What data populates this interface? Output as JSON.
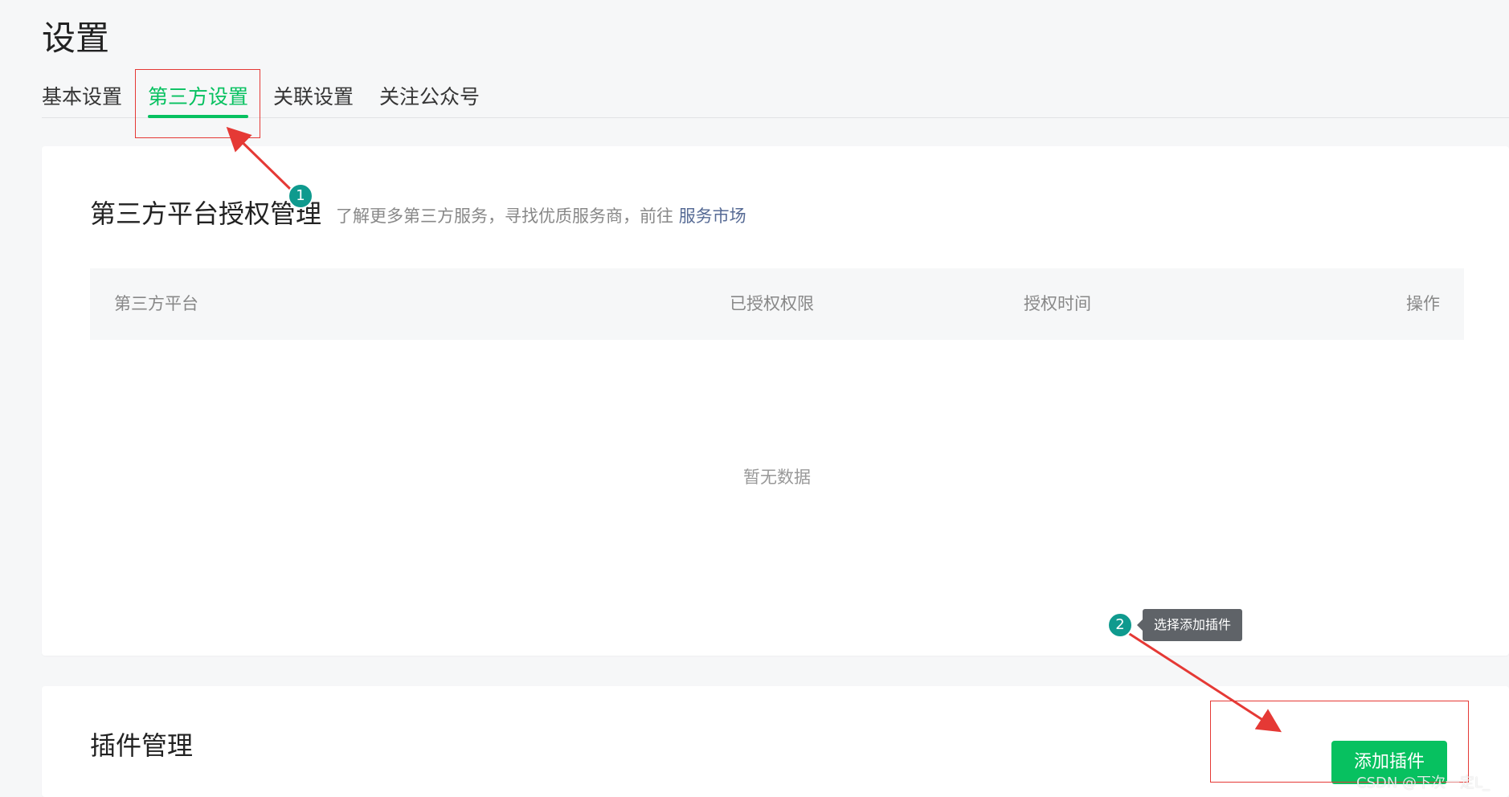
{
  "page": {
    "title": "设置"
  },
  "tabs": [
    {
      "label": "基本设置",
      "active": false
    },
    {
      "label": "第三方设置",
      "active": true
    },
    {
      "label": "关联设置",
      "active": false
    },
    {
      "label": "关注公众号",
      "active": false
    }
  ],
  "third_party": {
    "title": "第三方平台授权管理",
    "description": "了解更多第三方服务，寻找优质服务商，前往",
    "market_link": "服务市场",
    "columns": [
      "第三方平台",
      "已授权权限",
      "授权时间",
      "操作"
    ],
    "empty_text": "暂无数据"
  },
  "plugins": {
    "title": "插件管理",
    "add_button": "添加插件"
  },
  "annotations": {
    "step1": "1",
    "step2": "2",
    "tooltip": "选择添加插件"
  },
  "watermark": "CSDN @下次一定L_",
  "colors": {
    "accent": "#07c160",
    "link": "#576b95",
    "annotation_red": "#e53935",
    "badge_teal": "#0f9a8e"
  }
}
